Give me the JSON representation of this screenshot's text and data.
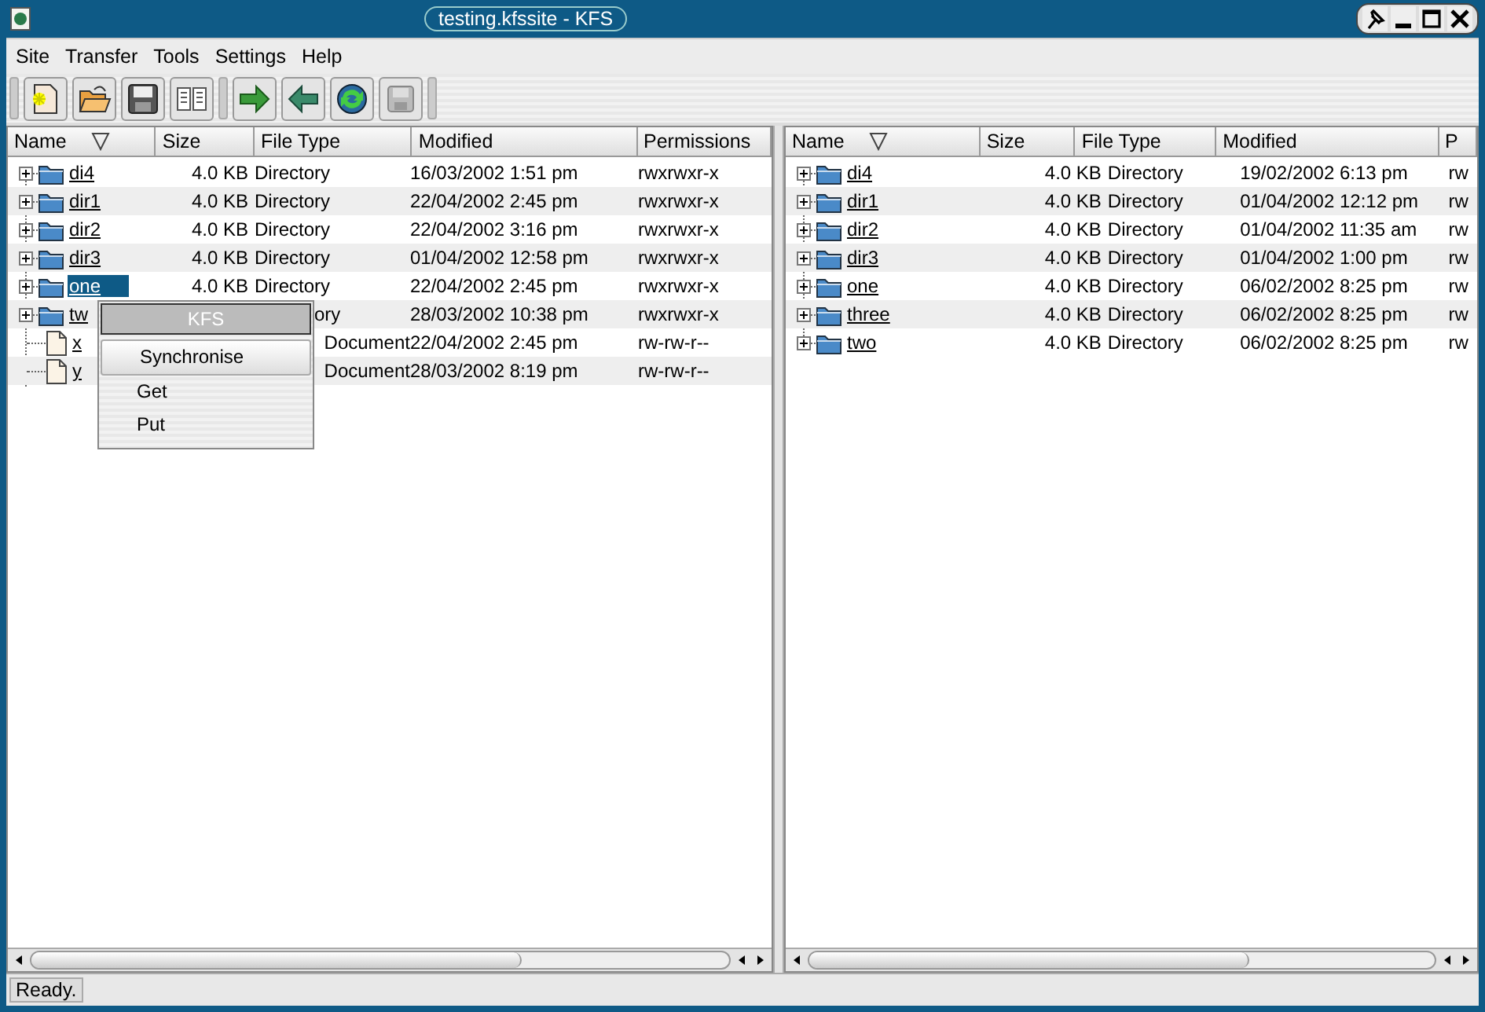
{
  "window": {
    "title": "testing.kfssite - KFS"
  },
  "menu": [
    "Site",
    "Transfer",
    "Tools",
    "Settings",
    "Help"
  ],
  "toolbar": [
    {
      "kind": "new"
    },
    {
      "kind": "open"
    },
    {
      "kind": "save"
    },
    {
      "kind": "list"
    },
    {
      "kind": "right"
    },
    {
      "kind": "left"
    },
    {
      "kind": "sync"
    },
    {
      "kind": "disk"
    }
  ],
  "panes": [
    {
      "columns": [
        "Name",
        "Size",
        "File Type",
        "Modified",
        "Permissions"
      ],
      "rows": [
        {
          "kind": "folder",
          "name": "di4",
          "size": "4.0 KB",
          "type": "Directory",
          "modified": "16/03/2002 1:51 pm",
          "permissions": "rwxrwxr-x",
          "selected": false
        },
        {
          "kind": "folder",
          "name": "dir1",
          "size": "4.0 KB",
          "type": "Directory",
          "modified": "22/04/2002 2:45 pm",
          "permissions": "rwxrwxr-x",
          "selected": false
        },
        {
          "kind": "folder",
          "name": "dir2",
          "size": "4.0 KB",
          "type": "Directory",
          "modified": "22/04/2002 3:16 pm",
          "permissions": "rwxrwxr-x",
          "selected": false
        },
        {
          "kind": "folder",
          "name": "dir3",
          "size": "4.0 KB",
          "type": "Directory",
          "modified": "01/04/2002 12:58 pm",
          "permissions": "rwxrwxr-x",
          "selected": false
        },
        {
          "kind": "folder",
          "name": "one",
          "size": "4.0 KB",
          "type": "Directory",
          "modified": "22/04/2002 2:45 pm",
          "permissions": "rwxrwxr-x",
          "selected": true
        },
        {
          "kind": "folder",
          "name": "tw",
          "type": "ory",
          "modified": "28/03/2002 10:38 pm",
          "permissions": "rwxrwxr-x",
          "selected": false
        },
        {
          "kind": "file",
          "name": "x",
          "type": "Document",
          "modified": "22/04/2002 2:45 pm",
          "permissions": "rw-rw-r--",
          "selected": false
        },
        {
          "kind": "file",
          "name": "y",
          "type": "Document",
          "modified": "28/03/2002 8:19 pm",
          "permissions": "rw-rw-r--",
          "selected": false
        }
      ]
    },
    {
      "columns": [
        "Name",
        "Size",
        "File Type",
        "Modified",
        "P"
      ],
      "rows": [
        {
          "kind": "folder",
          "name": "di4",
          "size": "4.0 KB",
          "type": "Directory",
          "modified": "19/02/2002 6:13 pm",
          "permissions": "rw",
          "selected": false
        },
        {
          "kind": "folder",
          "name": "dir1",
          "size": "4.0 KB",
          "type": "Directory",
          "modified": "01/04/2002 12:12 pm",
          "permissions": "rw",
          "selected": false
        },
        {
          "kind": "folder",
          "name": "dir2",
          "size": "4.0 KB",
          "type": "Directory",
          "modified": "01/04/2002 11:35 am",
          "permissions": "rw",
          "selected": false
        },
        {
          "kind": "folder",
          "name": "dir3",
          "size": "4.0 KB",
          "type": "Directory",
          "modified": "01/04/2002 1:00 pm",
          "permissions": "rw",
          "selected": false
        },
        {
          "kind": "folder",
          "name": "one",
          "size": "4.0 KB",
          "type": "Directory",
          "modified": "06/02/2002 8:25 pm",
          "permissions": "rw",
          "selected": false
        },
        {
          "kind": "folder",
          "name": "three",
          "size": "4.0 KB",
          "type": "Directory",
          "modified": "06/02/2002 8:25 pm",
          "permissions": "rw",
          "selected": false
        },
        {
          "kind": "folder",
          "name": "two",
          "size": "4.0 KB",
          "type": "Directory",
          "modified": "06/02/2002 8:25 pm",
          "permissions": "rw",
          "selected": false
        }
      ]
    }
  ],
  "context_menu": {
    "title": "KFS",
    "items": [
      {
        "label": "Synchronise",
        "selected": true
      },
      {
        "label": "Get",
        "selected": false
      },
      {
        "label": "Put",
        "selected": false
      }
    ]
  },
  "status_bar": "Ready."
}
